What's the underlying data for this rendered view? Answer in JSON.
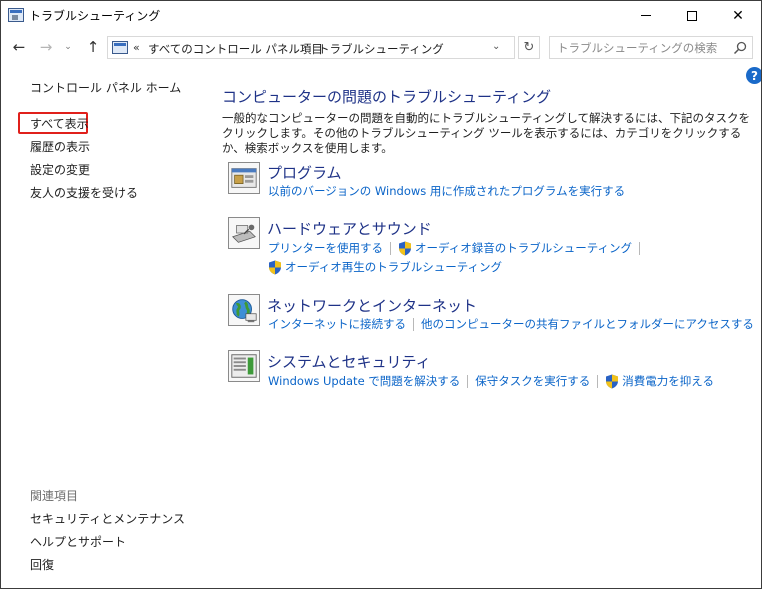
{
  "window": {
    "title": "トラブルシューティング",
    "controls": {
      "minimize": "—",
      "maximize": "☐",
      "close": "✕"
    }
  },
  "navigation": {
    "back_glyph": "←",
    "forward_glyph": "→",
    "recent_glyph": "⌄",
    "up_glyph": "↑",
    "breadcrumb_prefix": "«",
    "breadcrumbs": [
      "すべてのコントロール パネル項目",
      "トラブルシューティング"
    ],
    "breadcrumb_separator": "›",
    "address_dropdown_glyph": "⌄",
    "refresh_glyph": "↻",
    "search_placeholder": "トラブルシューティングの検索"
  },
  "help": {
    "label": "?"
  },
  "sidebar": {
    "home": "コントロール パネル ホーム",
    "links": [
      "すべて表示",
      "履歴の表示",
      "設定の変更",
      "友人の支援を受ける"
    ],
    "highlighted_index": 0,
    "related_title": "関連項目",
    "related_links": [
      "セキュリティとメンテナンス",
      "ヘルプとサポート",
      "回復"
    ]
  },
  "main": {
    "title": "コンピューターの問題のトラブルシューティング",
    "description": "一般的なコンピューターの問題を自動的にトラブルシューティングして解決するには、下記のタスクをクリックします。その他のトラブルシューティング ツールを表示するには、カテゴリをクリックするか、検索ボックスを使用します。",
    "categories": [
      {
        "title": "プログラム",
        "icon": "programs-icon",
        "tasks": [
          {
            "label": "以前のバージョンの Windows 用に作成されたプログラムを実行する",
            "shield": false
          }
        ]
      },
      {
        "title": "ハードウェアとサウンド",
        "icon": "hardware-sound-icon",
        "tasks": [
          {
            "label": "プリンターを使用する",
            "shield": false
          },
          {
            "label": "オーディオ録音のトラブルシューティング",
            "shield": true
          },
          {
            "label": "オーディオ再生のトラブルシューティング",
            "shield": true
          }
        ]
      },
      {
        "title": "ネットワークとインターネット",
        "icon": "network-internet-icon",
        "tasks": [
          {
            "label": "インターネットに接続する",
            "shield": false
          },
          {
            "label": "他のコンピューターの共有ファイルとフォルダーにアクセスする",
            "shield": false
          }
        ]
      },
      {
        "title": "システムとセキュリティ",
        "icon": "system-security-icon",
        "tasks": [
          {
            "label": "Windows Update で問題を解決する",
            "shield": false
          },
          {
            "label": "保守タスクを実行する",
            "shield": false
          },
          {
            "label": "消費電力を抑える",
            "shield": true
          }
        ]
      }
    ]
  },
  "colors": {
    "accent_link": "#0a64c8",
    "heading": "#1e3287",
    "highlight_box": "#e0201b",
    "help_button": "#1a6ac9"
  }
}
